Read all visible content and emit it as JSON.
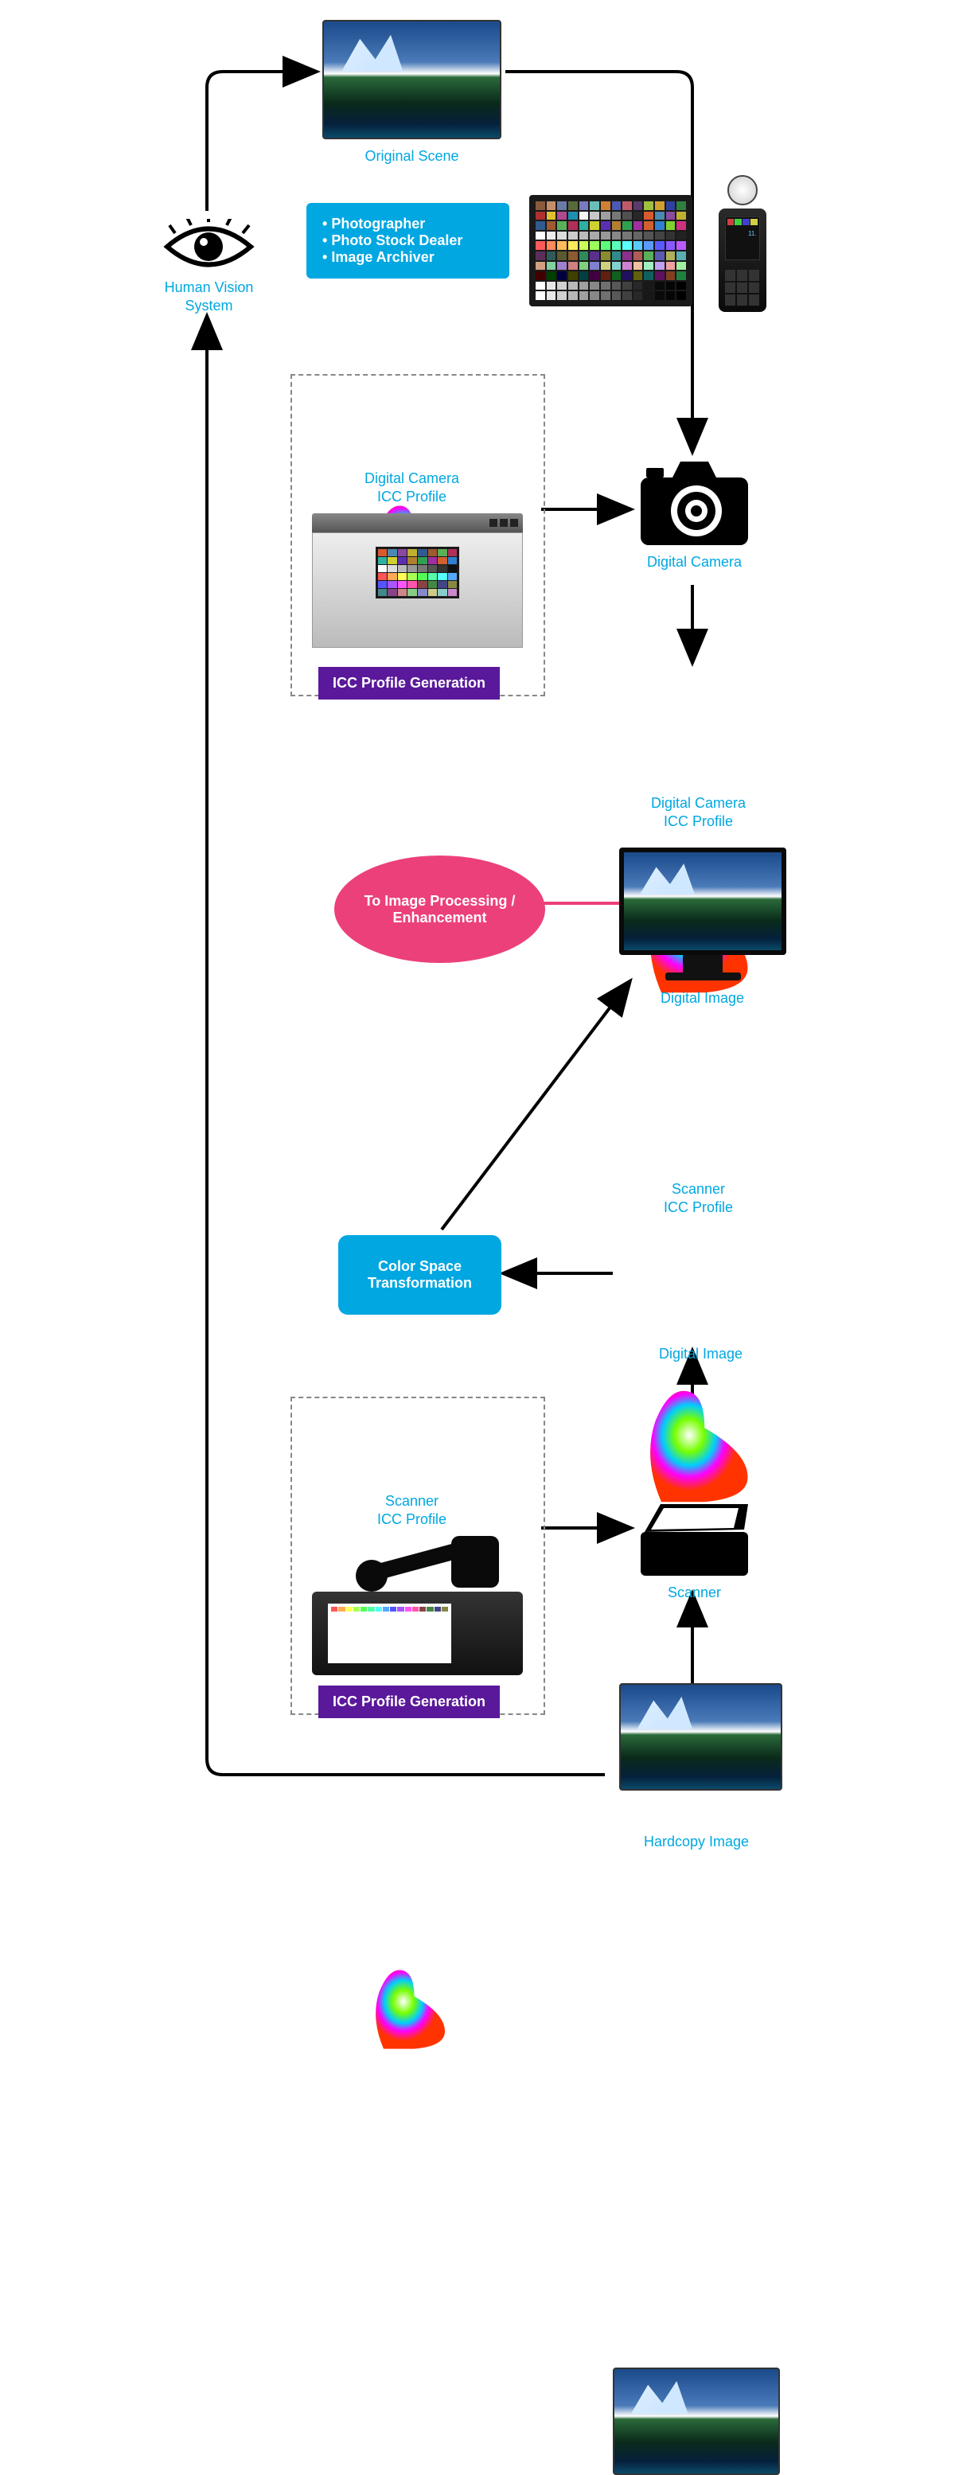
{
  "labels": {
    "human_vision": "Human Vision\nSystem",
    "original_scene": "Original Scene",
    "digital_camera": "Digital Camera",
    "cam_profile": "Digital Camera\nICC Profile",
    "cam_profile2": "Digital Camera\nICC Profile",
    "digital_image": "Digital Image",
    "digital_image2": "Digital Image",
    "scanner_profile": "Scanner\nICC Profile",
    "scanner_profile2": "Scanner\nICC Profile",
    "scanner": "Scanner",
    "hardcopy": "Hardcopy Image"
  },
  "roles": {
    "items": [
      "Photographer",
      "Photo Stock Dealer",
      "Image Archiver"
    ]
  },
  "purple": {
    "gen1": "ICC Profile Generation",
    "gen2": "ICC Profile Generation"
  },
  "pink": {
    "text": "To Image Processing /\nEnhancement"
  },
  "cst": {
    "text": "Color Space\nTransformation"
  }
}
